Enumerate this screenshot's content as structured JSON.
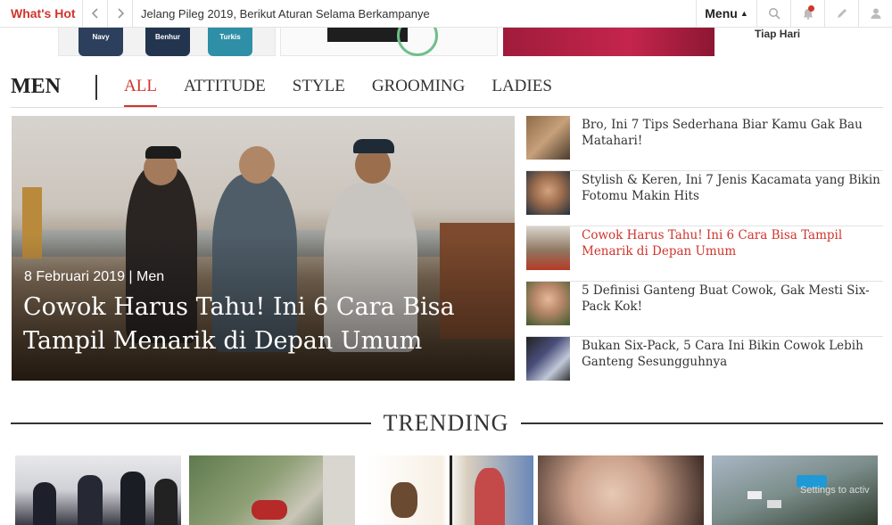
{
  "topbar": {
    "whats_hot": "What's Hot",
    "ticker": "Jelang Pileg 2019, Berikut Aturan Selama Berkampanye",
    "menu_label": "Menu",
    "icons": [
      "chevron-left-icon",
      "chevron-right-icon",
      "search-icon",
      "bell-icon",
      "pencil-icon",
      "user-icon"
    ]
  },
  "strip": {
    "shirts": [
      "Navy",
      "Benhur",
      "Turkis"
    ],
    "partial_text": "Tiap Hari"
  },
  "section": {
    "title": "MEN",
    "tabs": [
      {
        "label": "ALL",
        "active": true
      },
      {
        "label": "ATTITUDE",
        "active": false
      },
      {
        "label": "STYLE",
        "active": false
      },
      {
        "label": "GROOMING",
        "active": false
      },
      {
        "label": "LADIES",
        "active": false
      }
    ]
  },
  "hero": {
    "date": "8 Februari 2019",
    "separator": "|",
    "category": "Men",
    "title": "Cowok Harus Tahu! Ini 6 Cara Bisa Tampil Menarik di Depan Umum"
  },
  "side_articles": [
    {
      "title": "Bro, Ini 7 Tips Sederhana Biar Kamu Gak Bau Matahari!",
      "highlight": false
    },
    {
      "title": "Stylish & Keren, Ini 7 Jenis Kacamata yang Bikin Fotomu Makin Hits",
      "highlight": false
    },
    {
      "title": "Cowok Harus Tahu! Ini 6 Cara Bisa Tampil Menarik di Depan Umum",
      "highlight": true
    },
    {
      "title": "5 Definisi Ganteng Buat Cowok, Gak Mesti Six-Pack Kok!",
      "highlight": false
    },
    {
      "title": "Bukan Six-Pack, 5 Cara Ini Bikin Cowok Lebih Ganteng Sesungguhnya",
      "highlight": false
    }
  ],
  "trending": {
    "title": "TRENDING"
  },
  "watermark": "Settings to activ",
  "colors": {
    "accent": "#d0342c",
    "text": "#333333",
    "border": "#e3e3e3"
  }
}
